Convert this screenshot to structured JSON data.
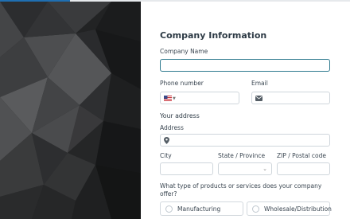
{
  "progress": {
    "fraction": 0.2
  },
  "form": {
    "title": "Company Information",
    "company_name": {
      "label": "Company Name",
      "value": "",
      "placeholder": ""
    },
    "phone": {
      "label": "Phone number",
      "country_icon": "us-flag-icon",
      "value": ""
    },
    "email": {
      "label": "Email",
      "icon": "mail-icon",
      "value": ""
    },
    "address_section": "Your address",
    "address": {
      "label": "Address",
      "icon": "map-pin-icon",
      "value": ""
    },
    "city": {
      "label": "City",
      "value": ""
    },
    "state": {
      "label": "State / Province",
      "value": ""
    },
    "zip": {
      "label": "ZIP / Postal code",
      "value": ""
    },
    "products_question": "What type of products or services does your company offer?",
    "product_options": [
      "Manufacturing",
      "Wholesale/Distribution"
    ]
  },
  "colors": {
    "accent": "#2f7a8f",
    "progress": "#1f6fb2",
    "panel": "#202224"
  }
}
